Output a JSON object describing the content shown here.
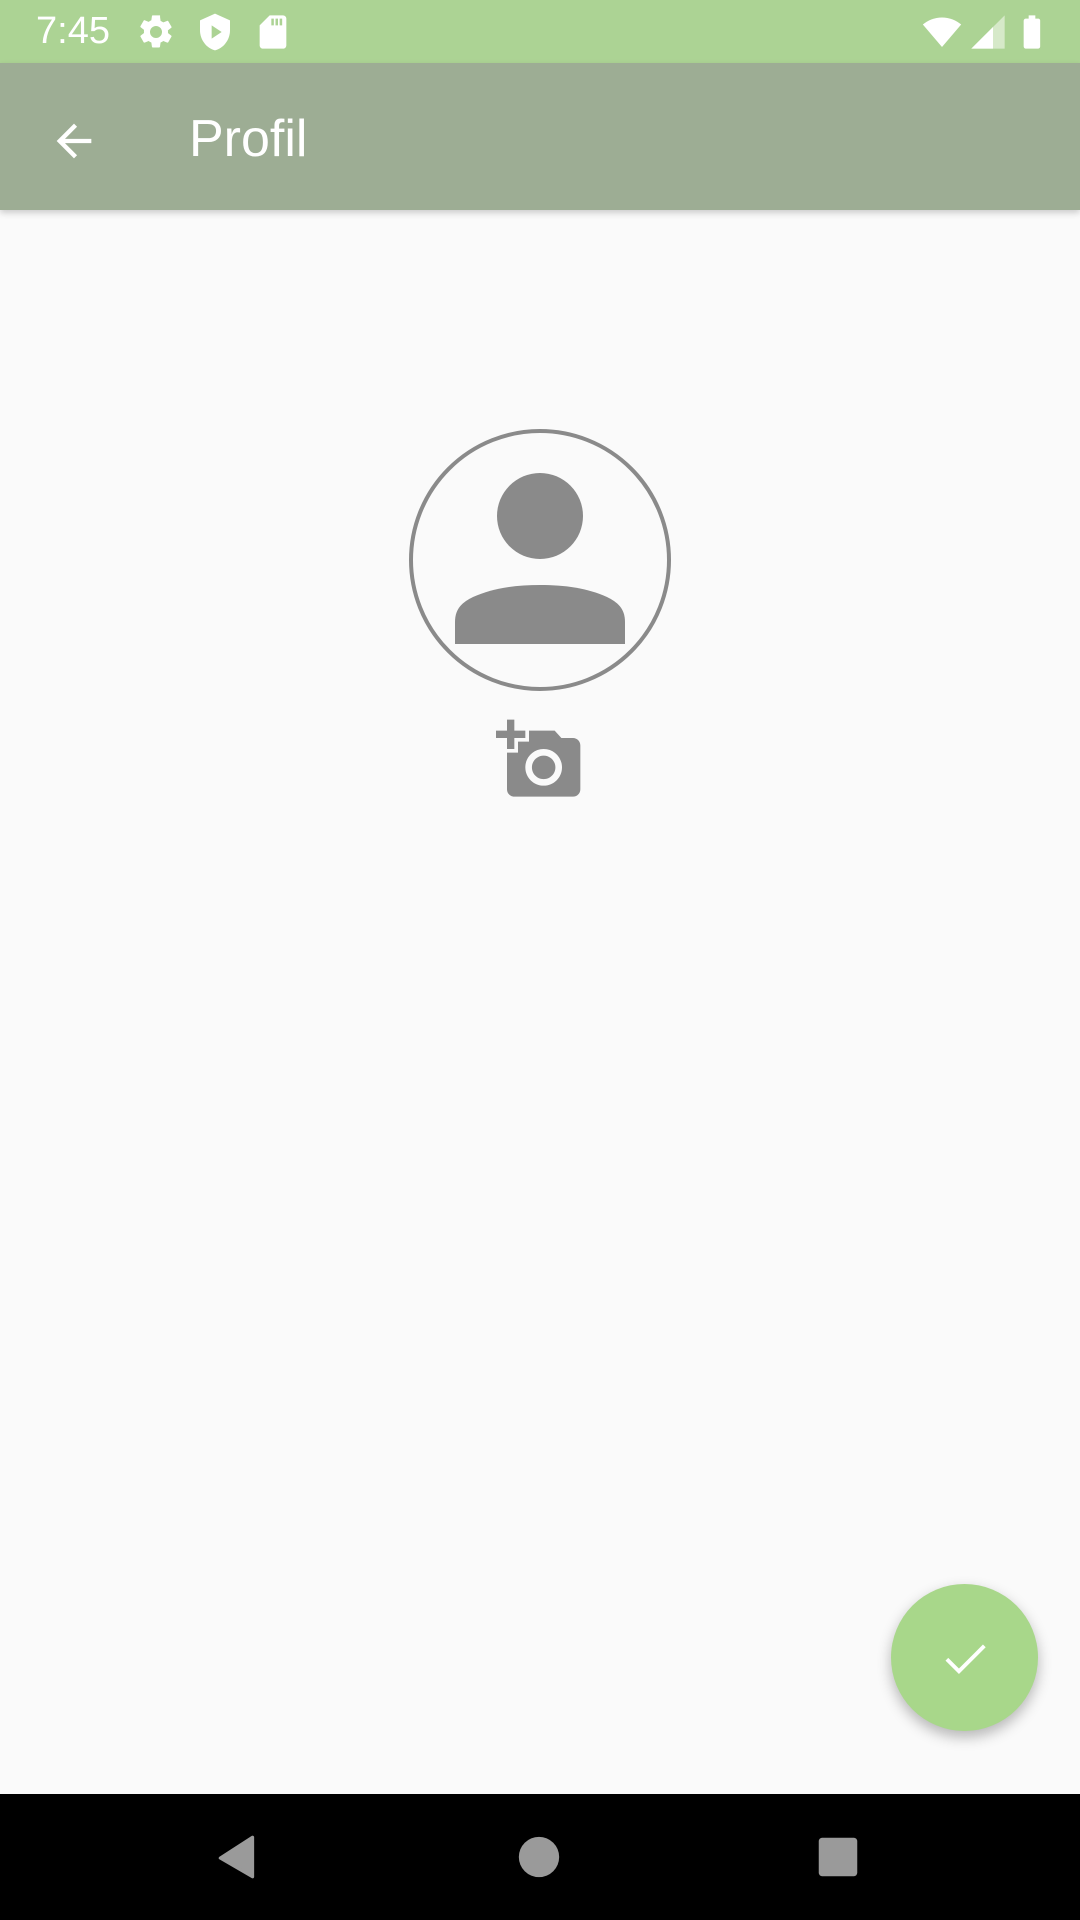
{
  "status_bar": {
    "time": "7:45",
    "left_icons": [
      "gear-icon",
      "shield-play-icon",
      "sd-card-icon"
    ],
    "right_icons": [
      "wifi-icon",
      "cell-signal-icon",
      "battery-icon"
    ],
    "background_color": "#acd394"
  },
  "toolbar": {
    "title": "Profil",
    "back_icon": "arrow-left-icon",
    "background_color": "#9dad94"
  },
  "profile": {
    "avatar_icon": "person-placeholder-icon",
    "add_photo_icon": "add-a-photo-icon",
    "icon_color": "#8a8a8a"
  },
  "fab": {
    "icon": "check-icon",
    "background_color": "#a8d78a"
  },
  "nav_bar": {
    "buttons": [
      "back-triangle-icon",
      "home-circle-icon",
      "recents-square-icon"
    ]
  }
}
